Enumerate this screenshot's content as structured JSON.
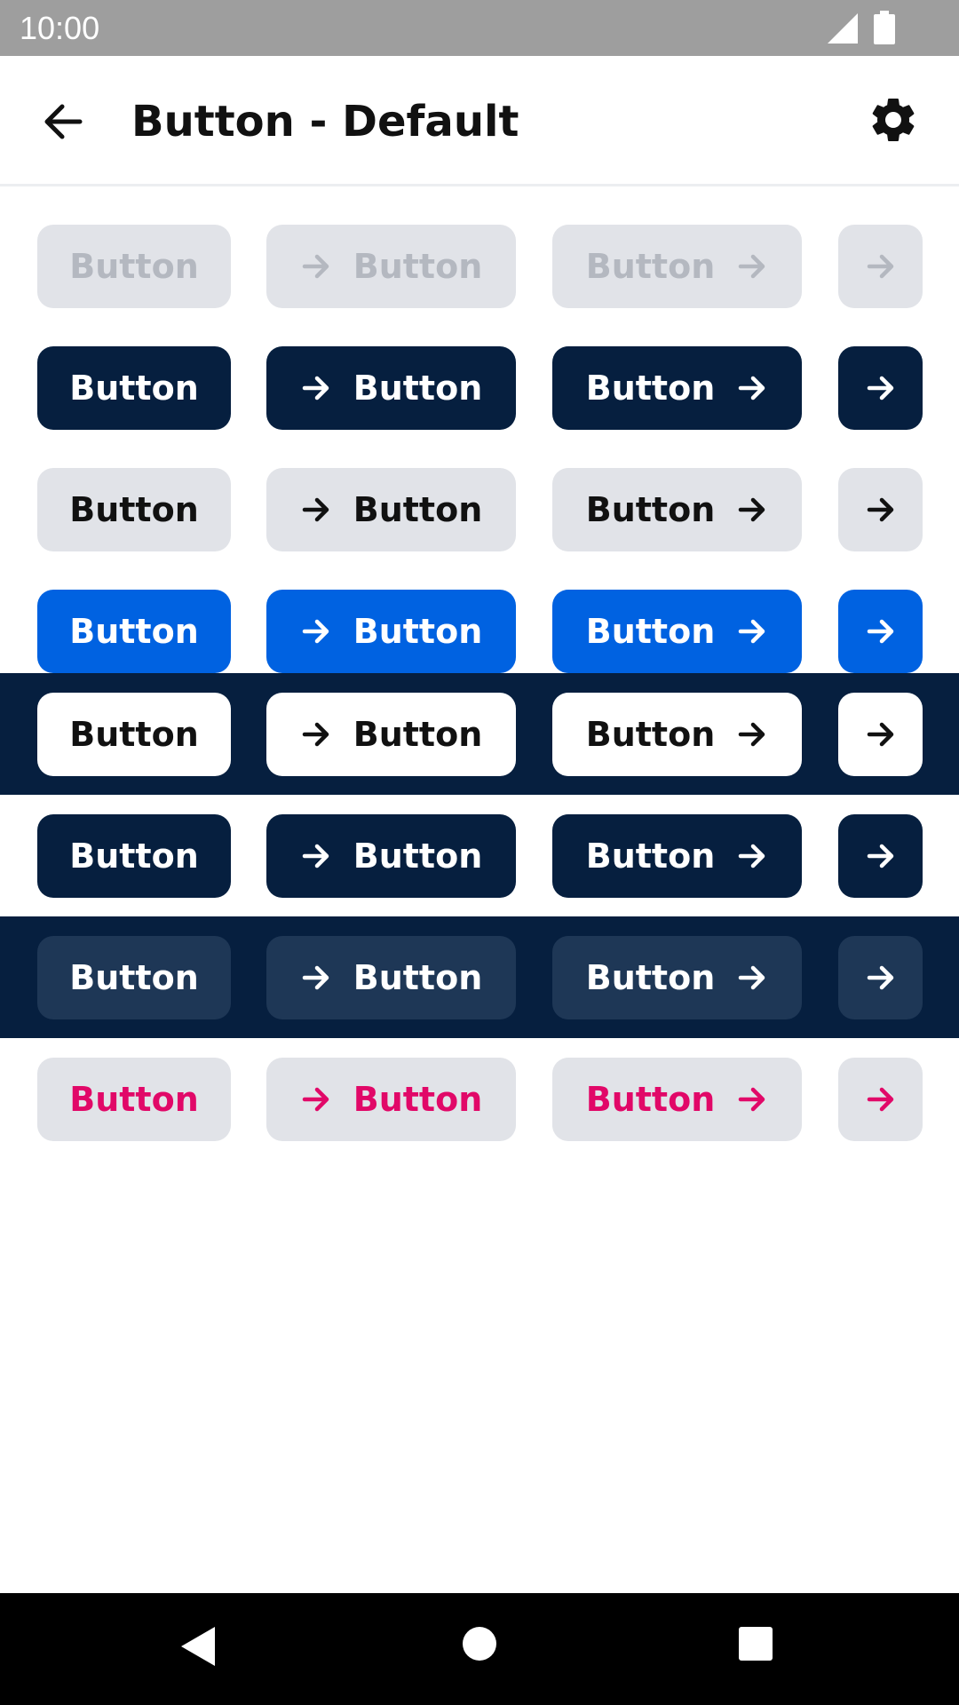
{
  "status_bar": {
    "time": "10:00"
  },
  "app_bar": {
    "title": "Button - Default"
  },
  "rows": [
    {
      "variant": "disabled",
      "bg": "#ffffff",
      "btn_bg": "#e1e3e8",
      "btn_fg": "#b4b8c0",
      "labels": [
        "Button",
        "Button",
        "Button"
      ]
    },
    {
      "variant": "primary",
      "bg": "#ffffff",
      "btn_bg": "#061f3f",
      "btn_fg": "#ffffff",
      "labels": [
        "Button",
        "Button",
        "Button"
      ]
    },
    {
      "variant": "secondary",
      "bg": "#ffffff",
      "btn_bg": "#e1e3e8",
      "btn_fg": "#111111",
      "labels": [
        "Button",
        "Button",
        "Button"
      ]
    },
    {
      "variant": "info",
      "bg": "#ffffff",
      "btn_bg": "#0062e1",
      "btn_fg": "#ffffff",
      "labels": [
        "Button",
        "Button",
        "Button"
      ]
    },
    {
      "variant": "white-on-dark",
      "bg": "#061f3f",
      "btn_bg": "#ffffff",
      "btn_fg": "#111111",
      "labels": [
        "Button",
        "Button",
        "Button"
      ]
    },
    {
      "variant": "dark",
      "bg": "#ffffff",
      "btn_bg": "#061f3f",
      "btn_fg": "#ffffff",
      "labels": [
        "Button",
        "Button",
        "Button"
      ]
    },
    {
      "variant": "subtle-on-dark",
      "bg": "#061f3f",
      "btn_bg": "#1e3756",
      "btn_fg": "#ffffff",
      "labels": [
        "Button",
        "Button",
        "Button"
      ]
    },
    {
      "variant": "critical",
      "bg": "#ffffff",
      "btn_bg": "#e1e3e8",
      "btn_fg": "#e10868",
      "labels": [
        "Button",
        "Button",
        "Button"
      ]
    }
  ],
  "icons": {
    "back": "arrow-left-icon",
    "settings": "gear-icon",
    "button_arrow": "arrow-right-icon"
  }
}
